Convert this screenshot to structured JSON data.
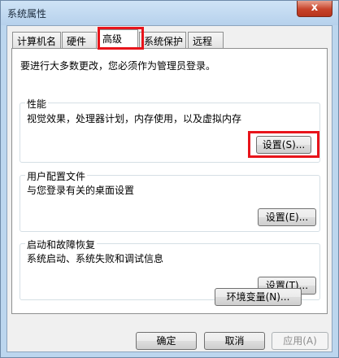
{
  "window": {
    "title": "系统属性",
    "close_glyph": "x"
  },
  "tabs": [
    {
      "label": "计算机名"
    },
    {
      "label": "硬件"
    },
    {
      "label": "高级",
      "active": true
    },
    {
      "label": "系统保护"
    },
    {
      "label": "远程"
    }
  ],
  "notice": "要进行大多数更改，您必须作为管理员登录。",
  "performance": {
    "title": "性能",
    "description": "视觉效果，处理器计划，内存使用，以及虚拟内存",
    "button": "设置(S)..."
  },
  "user_profiles": {
    "title": "用户配置文件",
    "description": "与您登录有关的桌面设置",
    "button": "设置(E)..."
  },
  "startup_recovery": {
    "title": "启动和故障恢复",
    "description": "系统启动、系统失败和调试信息",
    "button": "设置(T)..."
  },
  "env_button": "环境变量(N)...",
  "footer": {
    "ok": "确定",
    "cancel": "取消",
    "apply": "应用(A)"
  },
  "colors": {
    "highlight": "#e8141b",
    "window_frame": "#bcd6ee"
  }
}
